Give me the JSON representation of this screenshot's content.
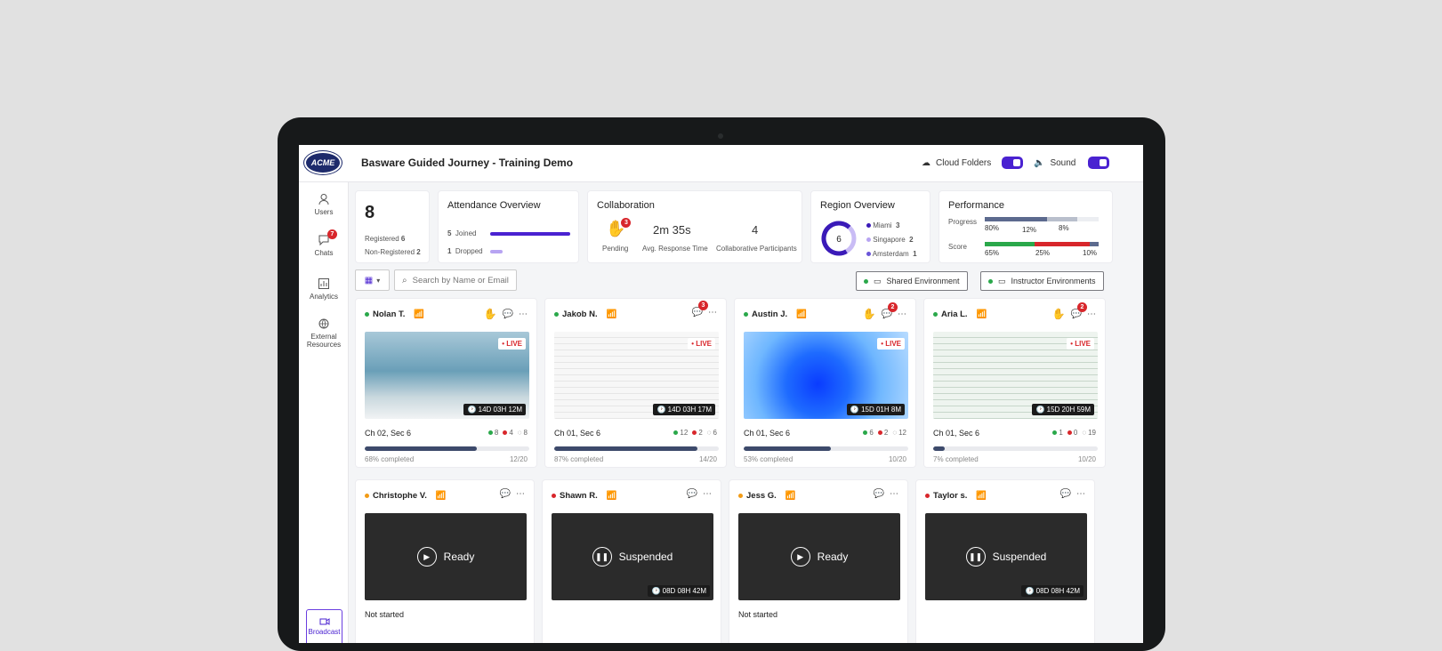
{
  "header": {
    "logo_text": "ACME",
    "title": "Basware Guided Journey - Training Demo",
    "cloud_label": "Cloud Folders",
    "sound_label": "Sound"
  },
  "sidebar": {
    "users": "Users",
    "chats": "Chats",
    "chats_badge": "7",
    "analytics": "Analytics",
    "external1": "External",
    "external2": "Resources",
    "broadcast": "Broadcast"
  },
  "stats": {
    "total": "8",
    "registered_label": "Registered",
    "registered": "6",
    "nonreg_label": "Non-Registered",
    "nonreg": "2",
    "attendance_title": "Attendance Overview",
    "joined_count": "5",
    "joined_label": "Joined",
    "joined_fraction": 1.0,
    "dropped_count": "1",
    "dropped_label": "Dropped",
    "collab_title": "Collaboration",
    "pending_badge": "3",
    "pending_label": "Pending",
    "response_value": "2m 35s",
    "response_label": "Avg. Response Time",
    "participants_value": "4",
    "participants_label": "Collaborative Participants",
    "region_title": "Region Overview",
    "region_total": "6",
    "regions": [
      {
        "name": "Miami",
        "count": "3"
      },
      {
        "name": "Singapore",
        "count": "2"
      },
      {
        "name": "Amsterdam",
        "count": "1"
      }
    ],
    "perf_title": "Performance",
    "progress_label": "Progress",
    "progress_a": "80%",
    "progress_b": "12%",
    "progress_c": "8%",
    "score_label": "Score",
    "score_a": "65%",
    "score_b": "25%",
    "score_c": "10%"
  },
  "toolbar": {
    "search_placeholder": "Search by Name or Email",
    "shared_env": "Shared Environment",
    "instructor_env": "Instructor Environments"
  },
  "cards": [
    {
      "name": "Nolan T.",
      "chapter": "Ch 02, Sec 6",
      "ok": "8",
      "err": "4",
      "pend": "8",
      "pct": "68% completed",
      "frac": "12/20",
      "progress": 0.68,
      "timer": "14D 03H 12M",
      "live": "LIVE"
    },
    {
      "name": "Jakob N.",
      "chapter": "Ch 01, Sec 6",
      "ok": "12",
      "err": "2",
      "pend": "6",
      "pct": "87% completed",
      "frac": "14/20",
      "progress": 0.87,
      "timer": "14D 03H 17M",
      "live": "LIVE",
      "chat_badge": "3"
    },
    {
      "name": "Austin J.",
      "chapter": "Ch 01, Sec 6",
      "ok": "6",
      "err": "2",
      "pend": "12",
      "pct": "53% completed",
      "frac": "10/20",
      "progress": 0.53,
      "timer": "15D 01H 8M",
      "live": "LIVE",
      "chat_badge": "2"
    },
    {
      "name": "Aria L.",
      "chapter": "Ch 01, Sec 6",
      "ok": "1",
      "err": "0",
      "pend": "19",
      "pct": "7% completed",
      "frac": "10/20",
      "progress": 0.07,
      "timer": "15D 20H 59M",
      "live": "LIVE",
      "chat_badge": "2"
    }
  ],
  "cards2": [
    {
      "name": "Christophe V.",
      "state": "Ready",
      "foot": "Not started"
    },
    {
      "name": "Shawn R.",
      "state": "Suspended",
      "timer": "08D 08H 42M"
    },
    {
      "name": "Jess G.",
      "state": "Ready",
      "foot": "Not started"
    },
    {
      "name": "Taylor s.",
      "state": "Suspended",
      "timer": "08D 08H 42M"
    }
  ]
}
